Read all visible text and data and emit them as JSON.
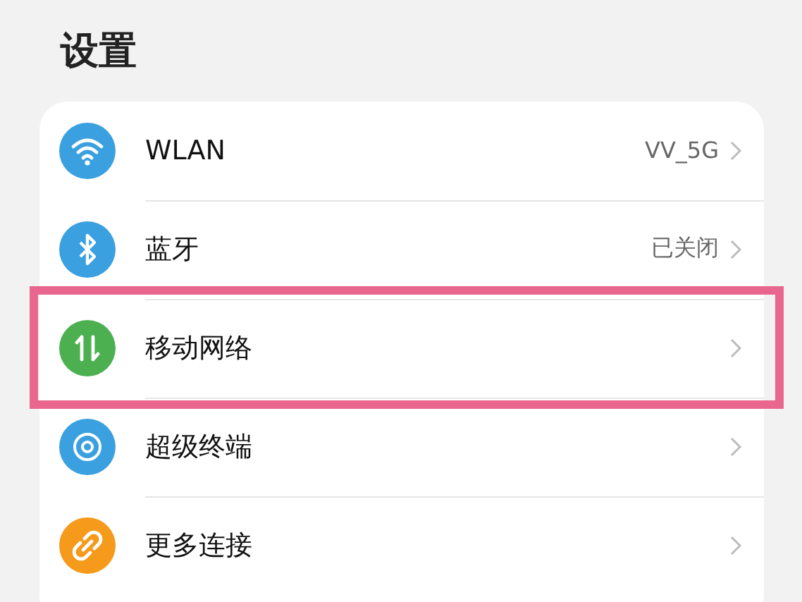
{
  "title": "设置",
  "items": [
    {
      "label": "WLAN",
      "value": "VV_5G",
      "kind": "wifi",
      "color": "#3aa0e0",
      "highlighted": false
    },
    {
      "label": "蓝牙",
      "value": "已关闭",
      "kind": "bluetooth",
      "color": "#3aa0e0",
      "highlighted": false
    },
    {
      "label": "移动网络",
      "kind": "data",
      "color": "#4cb050",
      "highlighted": true
    },
    {
      "label": "超级终端",
      "kind": "device",
      "color": "#3aa0e0",
      "highlighted": false
    },
    {
      "label": "更多连接",
      "kind": "link",
      "color": "#f59a1b",
      "highlighted": false
    }
  ]
}
